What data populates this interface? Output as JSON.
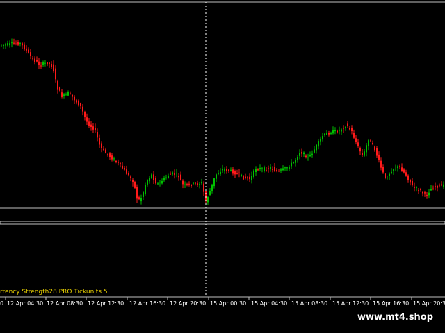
{
  "indicator": {
    "label": "rrency Strength28 PRO  Tickunits 5"
  },
  "time_axis": {
    "labels": [
      "0",
      "12 Apr 04:30",
      "12 Apr 08:30",
      "12 Apr 12:30",
      "12 Apr 16:30",
      "12 Apr 20:30",
      "15 Apr 00:30",
      "15 Apr 04:30",
      "15 Apr 08:30",
      "15 Apr 12:30",
      "15 Apr 16:30",
      "15 Apr 20:30"
    ]
  },
  "watermark": {
    "text": "www.mt4.shop"
  },
  "colors": {
    "background": "#000000",
    "bull_candle": "#00c000",
    "bear_candle": "#ff1a1a",
    "indicator_text": "#e8d000",
    "axis_text": "#ffffff",
    "separator": "#c0c0c0"
  }
}
